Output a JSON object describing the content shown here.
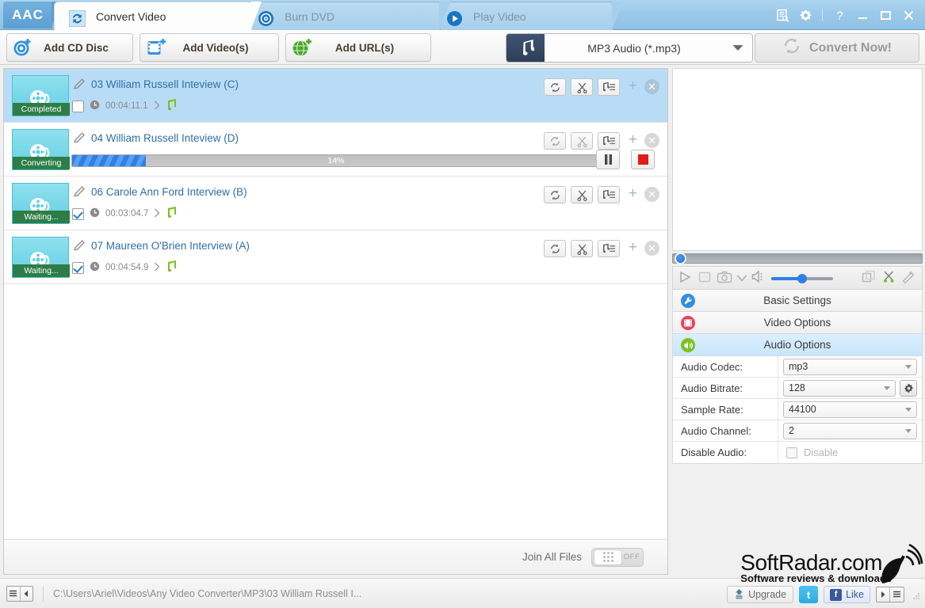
{
  "window": {
    "logo": "AAC",
    "tabs": [
      {
        "label": "Convert Video",
        "icon": "convert-icon",
        "active": true
      },
      {
        "label": "Burn DVD",
        "icon": "disc-icon",
        "active": false
      },
      {
        "label": "Play Video",
        "icon": "play-icon",
        "active": false
      }
    ],
    "controls": [
      {
        "name": "task-list-icon",
        "glyph": "list"
      },
      {
        "name": "settings-gear-icon",
        "glyph": "gear"
      },
      {
        "name": "help-button",
        "glyph": "?"
      },
      {
        "name": "minimize-button",
        "glyph": "_"
      },
      {
        "name": "maximize-button",
        "glyph": "□"
      },
      {
        "name": "close-button",
        "glyph": "✕"
      }
    ]
  },
  "toolbar": {
    "add_cd_disc": "Add CD Disc",
    "add_videos": "Add Video(s)",
    "add_urls": "Add URL(s)",
    "format_value": "MP3 Audio (*.mp3)",
    "convert_now": "Convert Now!"
  },
  "file_list": {
    "items": [
      {
        "index": 1,
        "name": "03 William Russell Inteview (C)",
        "status": "Completed",
        "duration": "00:04:11.1",
        "checked": false,
        "selected": true,
        "mode": "info"
      },
      {
        "index": 2,
        "name": "04 William Russell Inteview (D)",
        "status": "Converting",
        "progress": 14,
        "progress_label": "14%",
        "checked": false,
        "selected": false,
        "mode": "progress"
      },
      {
        "index": 3,
        "name": "06 Carole Ann Ford Interview (B)",
        "status": "Waiting...",
        "duration": "00:03:04.7",
        "checked": true,
        "selected": false,
        "mode": "info"
      },
      {
        "index": 4,
        "name": "07 Maureen O'Brien Interview (A)",
        "status": "Waiting...",
        "duration": "00:04:54.9",
        "checked": true,
        "selected": false,
        "mode": "info"
      }
    ],
    "row_actions": [
      "refresh-icon",
      "scissors-icon",
      "playlist-icon"
    ],
    "join_all_files_label": "Join All Files",
    "join_toggle_state": "OFF"
  },
  "right_panel": {
    "sections": [
      {
        "label": "Basic Settings",
        "icon": "wrench-icon",
        "icon_color": "#2f8fe0",
        "active": false
      },
      {
        "label": "Video Options",
        "icon": "film-icon",
        "icon_color": "#e8415f",
        "active": false
      },
      {
        "label": "Audio Options",
        "icon": "speaker-icon",
        "icon_color": "#7cc11e",
        "active": true
      }
    ],
    "audio_options": [
      {
        "label": "Audio Codec:",
        "value": "mp3",
        "type": "select",
        "gear": false
      },
      {
        "label": "Audio Bitrate:",
        "value": "128",
        "type": "select",
        "gear": true
      },
      {
        "label": "Sample Rate:",
        "value": "44100",
        "type": "select",
        "gear": false
      },
      {
        "label": "Audio Channel:",
        "value": "2",
        "type": "select",
        "gear": false
      },
      {
        "label": "Disable Audio:",
        "value": "Disable",
        "type": "checkbox",
        "checked": false
      }
    ]
  },
  "status_bar": {
    "path": "C:\\Users\\Ariel\\Videos\\Any Video Converter\\MP3\\03 William Russell I...",
    "upgrade": "Upgrade",
    "twitter": "t",
    "facebook_like": "Like",
    "facebook_icon": "f"
  },
  "watermark": {
    "line1": "SoftRadar.com",
    "line2": "Software reviews & downloads"
  },
  "colors": {
    "accent_blue": "#2f7fe8",
    "title_bar": "#9cc9e9",
    "selected_row": "#b9dcf6",
    "status_green": "#2e7d46",
    "thumb_cyan": "#63cfe2"
  }
}
